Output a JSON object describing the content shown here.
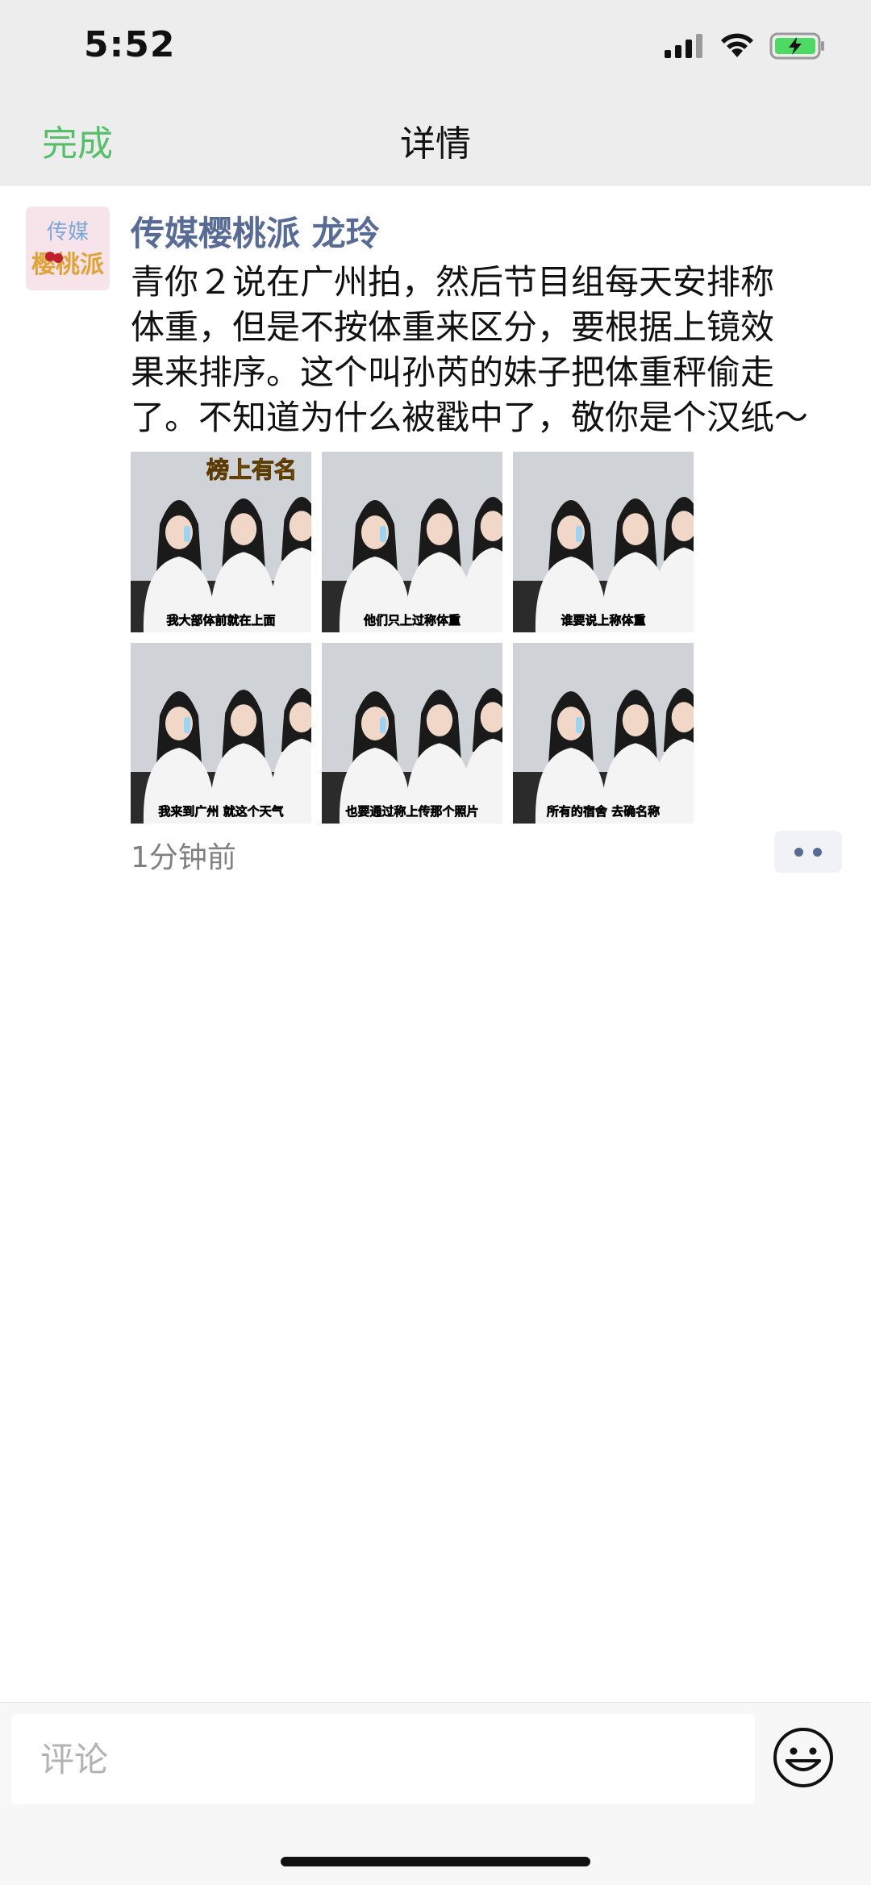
{
  "status_bar": {
    "time": "5:52",
    "icons": [
      "signal-icon",
      "wifi-icon",
      "battery-charging-icon"
    ],
    "battery_color": "#4cd964"
  },
  "nav": {
    "done_label": "完成",
    "title": "详情",
    "accent_color": "#57be6a"
  },
  "post": {
    "avatar_lines": [
      "传媒",
      "樱桃派"
    ],
    "author": "传媒樱桃派 龙玲",
    "text_lines": [
      "青你２说在广州拍，然后节目组每天安排称",
      "体重，但是不按体重来区分，要根据上镜效",
      "果来排序。这个叫孙芮的妹子把体重秤偷走",
      "了。不知道为什么被戳中了，敬你是个汉纸～"
    ],
    "images": [
      {
        "caption": "我大部体前就在上面",
        "overlay": "榜上有名"
      },
      {
        "caption": "他们只上过称体重",
        "overlay": ""
      },
      {
        "caption": "谁要说上称体重",
        "overlay": ""
      },
      {
        "caption": "我来到广州 就这个天气",
        "overlay": ""
      },
      {
        "caption": "也要通过称上传那个照片",
        "overlay": ""
      },
      {
        "caption": "所有的宿舍 去确名称",
        "overlay": ""
      }
    ],
    "timestamp": "1分钟前"
  },
  "comment": {
    "placeholder": "评论",
    "value": ""
  },
  "colors": {
    "author_link": "#576b95",
    "nav_bg": "#ededed"
  }
}
